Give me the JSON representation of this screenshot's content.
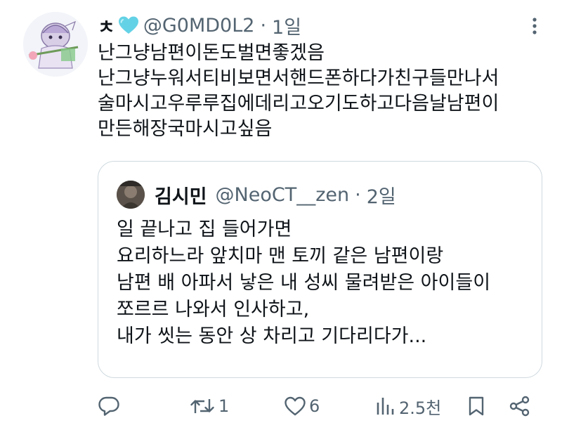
{
  "tweet": {
    "display_name": "ㅊ",
    "handle": "@G0MD0L2",
    "separator": "·",
    "time": "1일",
    "lines": [
      "난그냥남편이돈도벌면좋겠음",
      "난그냥누워서티비보면서핸드폰하다가친구들만나서",
      "술마시고우루루집에데리고오기도하고다음날남편이",
      "만든해장국마시고싶음"
    ]
  },
  "quote": {
    "display_name": "김시민",
    "handle": "@NeoCT__zen",
    "separator": "·",
    "time": "2일",
    "lines": [
      "일 끝나고 집 들어가면",
      "요리하느라 앞치마 맨 토끼 같은 남편이랑",
      "남편 배 아파서 낳은 내 성씨 물려받은 아이들이",
      "쪼르르 나와서 인사하고,",
      "내가 씻는 동안 상 차리고 기다리다가..."
    ]
  },
  "actions": {
    "reply_count": "",
    "retweet_count": "1",
    "like_count": "6",
    "view_count": "2.5천"
  },
  "icons": {
    "heart_emoji": "light-blue-heart",
    "reply": "reply-icon",
    "retweet": "retweet-icon",
    "like": "like-icon",
    "views": "views-icon",
    "bookmark": "bookmark-icon",
    "share": "share-icon",
    "more": "more-icon"
  },
  "colors": {
    "text": "#0f1419",
    "secondary": "#536471",
    "border": "#cfd9de",
    "heart_emoji": "#64d2e6"
  }
}
